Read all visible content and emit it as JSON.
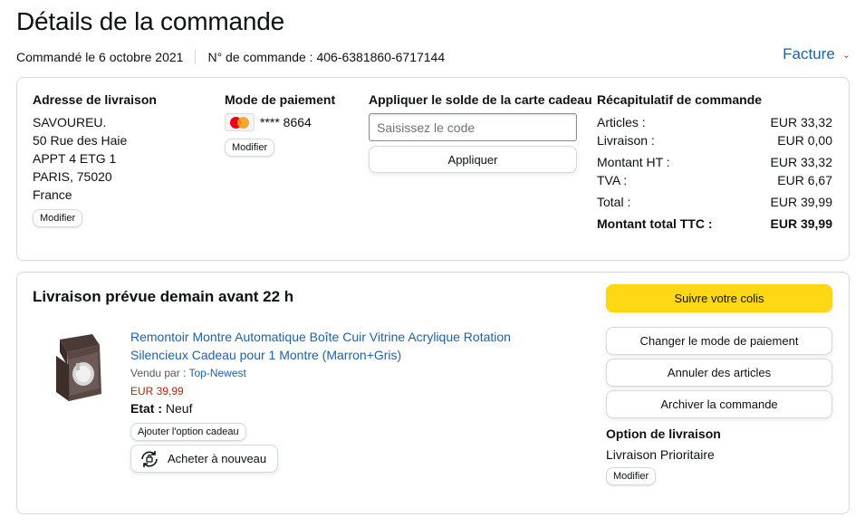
{
  "page": {
    "title": "Détails de la commande",
    "order_date": "Commandé le 6 octobre 2021",
    "order_number": "N° de commande : 406-6381860-6717144",
    "invoice_label": "Facture"
  },
  "shipping_address": {
    "title": "Adresse de livraison",
    "lines": [
      "SAVOUREU.",
      "50 Rue des Haie",
      "APPT 4 ETG 1",
      "PARIS, 75020",
      "France"
    ],
    "modify_label": "Modifier"
  },
  "payment": {
    "title": "Mode de paiement",
    "card_icon": "mastercard-icon",
    "card_digits": "**** 8664",
    "modify_label": "Modifier"
  },
  "gift_card": {
    "title": "Appliquer le solde de la carte cadeau",
    "placeholder": "Saisissez le code",
    "apply_label": "Appliquer"
  },
  "summary": {
    "title": "Récapitulatif de commande",
    "rows": [
      {
        "label": "Articles :",
        "value": "EUR 33,32"
      },
      {
        "label": "Livraison :",
        "value": "EUR 0,00"
      },
      {
        "label": "Montant HT :",
        "value": "EUR 33,32"
      },
      {
        "label": "TVA :",
        "value": "EUR 6,67"
      },
      {
        "label": "Total :",
        "value": "EUR 39,99"
      }
    ],
    "grand_total_label": "Montant total TTC :",
    "grand_total_value": "EUR 39,99"
  },
  "delivery": {
    "title": "Livraison prévue demain avant 22 h",
    "product": {
      "title": "Remontoir Montre Automatique Boîte Cuir Vitrine Acrylique Rotation Silencieux Cadeau pour 1 Montre (Marron+Gris)",
      "sold_by_label": "Vendu par : ",
      "seller": "Top-Newest",
      "price": "EUR 39,99",
      "condition_label": "Etat :",
      "condition_value": "Neuf",
      "gift_option_label": "Ajouter l'option cadeau",
      "rebuy_label": "Acheter à nouveau"
    },
    "actions": {
      "track": "Suivre votre colis",
      "change_payment": "Changer le mode de paiement",
      "cancel": "Annuler des articles",
      "archive": "Archiver la commande"
    },
    "shipping_option": {
      "title": "Option de livraison",
      "value": "Livraison Prioritaire",
      "modify_label": "Modifier"
    }
  },
  "colors": {
    "link": "#2162a1",
    "price": "#b12704",
    "primary_button": "#ffd814",
    "border": "#d5d9d9"
  }
}
